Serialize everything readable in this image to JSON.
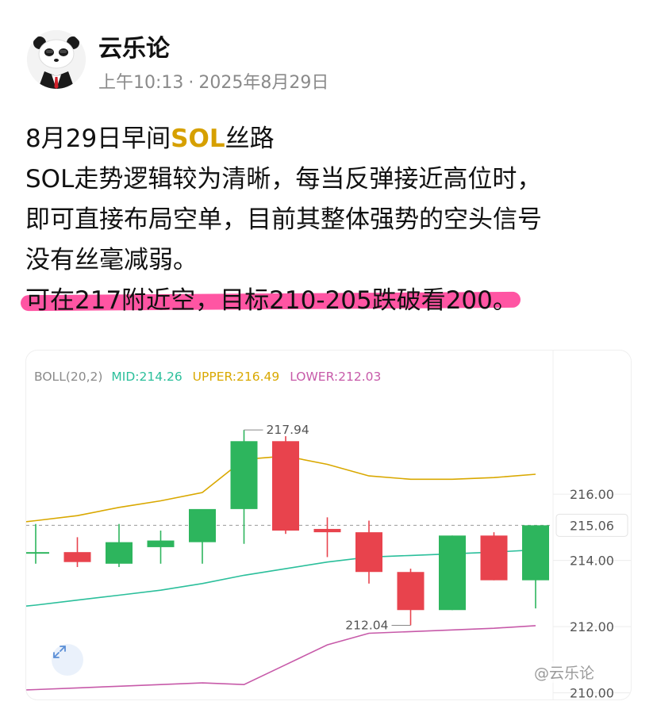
{
  "post": {
    "author": "云乐论",
    "time": "上午10:13",
    "date": "2025年8月29日",
    "title_prefix": "8月29日早间",
    "title_symbol": "SOL",
    "title_suffix": "丝路",
    "line2": "SOL走势逻辑较为清晰，每当反弹接近高位时，",
    "line3": "即可直接布局空单，目前其整体强势的空头信号",
    "line4": "没有丝毫减弱。",
    "line5": "可在217附近空，目标210-205跌破看200。"
  },
  "chart": {
    "indicator_name": "BOLL(20,2)",
    "mid_label": "MID:214.26",
    "upper_label": "UPPER:216.49",
    "lower_label": "LOWER:212.03",
    "watermark": "@云乐论",
    "expand_icon": "expand-arrows-icon"
  },
  "colors": {
    "up": "#2db55d",
    "down": "#e8434d",
    "mid": "#2bbf9b",
    "upper": "#d9a800",
    "lower": "#c75aa9",
    "highlight": "#ff2f8f"
  },
  "chart_data": {
    "type": "candlestick",
    "y_ticks": [
      "216.00",
      "214.00",
      "212.00",
      "210.00"
    ],
    "y_tick_values": [
      216,
      214,
      212,
      210
    ],
    "last_price": 215.06,
    "last_price_label": "215.06",
    "high_label": "217.94",
    "high_value": 217.94,
    "low_label": "212.04",
    "low_value": 212.04,
    "ylim": [
      209.8,
      218.9
    ],
    "candles": [
      {
        "open": 214.25,
        "high": 215.1,
        "low": 213.9,
        "close": 214.25
      },
      {
        "open": 214.25,
        "high": 214.7,
        "low": 213.8,
        "close": 213.95
      },
      {
        "open": 213.9,
        "high": 215.1,
        "low": 213.8,
        "close": 214.55
      },
      {
        "open": 214.4,
        "high": 214.9,
        "low": 213.9,
        "close": 214.6
      },
      {
        "open": 214.55,
        "high": 215.05,
        "low": 213.9,
        "close": 215.55
      },
      {
        "open": 215.55,
        "high": 217.94,
        "low": 214.5,
        "close": 217.6
      },
      {
        "open": 217.6,
        "high": 217.75,
        "low": 214.8,
        "close": 214.9
      },
      {
        "open": 214.95,
        "high": 215.3,
        "low": 214.1,
        "close": 214.85
      },
      {
        "open": 214.85,
        "high": 215.2,
        "low": 213.3,
        "close": 213.65
      },
      {
        "open": 213.65,
        "high": 213.75,
        "low": 212.04,
        "close": 212.5
      },
      {
        "open": 212.5,
        "high": 214.75,
        "low": 212.5,
        "close": 214.75
      },
      {
        "open": 214.75,
        "high": 214.85,
        "low": 213.4,
        "close": 213.4
      },
      {
        "open": 213.4,
        "high": 215.06,
        "low": 212.55,
        "close": 215.06
      }
    ],
    "upper_band": [
      215.2,
      215.35,
      215.6,
      215.8,
      216.05,
      217.05,
      217.15,
      216.9,
      216.55,
      216.45,
      216.45,
      216.5,
      216.6
    ],
    "mid_band": [
      212.65,
      212.8,
      212.95,
      213.1,
      213.3,
      213.55,
      213.75,
      213.95,
      214.1,
      214.15,
      214.2,
      214.25,
      214.32
    ],
    "lower_band": [
      210.1,
      210.15,
      210.2,
      210.25,
      210.3,
      210.25,
      210.85,
      211.45,
      211.8,
      211.85,
      211.9,
      211.95,
      212.03
    ]
  }
}
